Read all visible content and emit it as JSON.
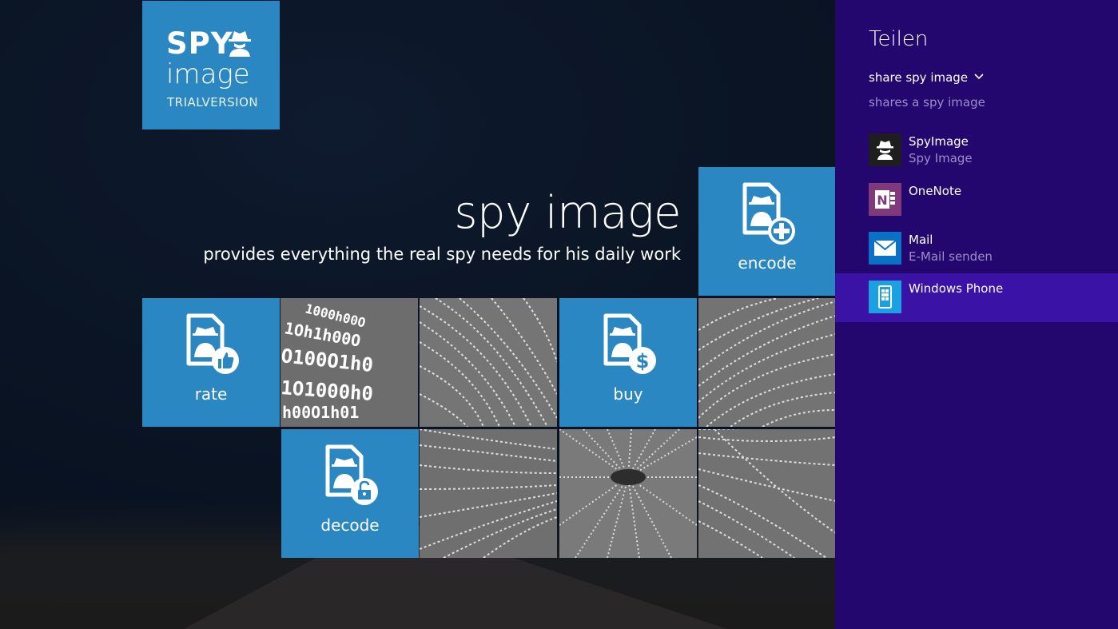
{
  "logo": {
    "line1": "SPY",
    "line2": "image",
    "line3": "TRIALVERSION"
  },
  "hero": {
    "title": "spy image",
    "subtitle": "provides everything the real spy needs for his daily work"
  },
  "tiles": {
    "encode": "encode",
    "rate": "rate",
    "buy": "buy",
    "decode": "decode"
  },
  "share": {
    "title": "Teilen",
    "app_name": "share spy image",
    "description": "shares a spy image",
    "targets": [
      {
        "name": "SpyImage",
        "subtitle": "Spy Image",
        "icon": "spy-icon",
        "color": "#1e1e1e"
      },
      {
        "name": "OneNote",
        "subtitle": "",
        "icon": "onenote-icon",
        "color": "#80397b"
      },
      {
        "name": "Mail",
        "subtitle": "E-Mail senden",
        "icon": "mail-icon",
        "color": "#0a72c6"
      },
      {
        "name": "Windows Phone",
        "subtitle": "",
        "icon": "windows-phone-icon",
        "color": "#1ba1e2"
      }
    ]
  },
  "colors": {
    "tile_blue": "#2a87c2",
    "charm_bg": "#23066e",
    "charm_selected": "#3a12a6"
  }
}
